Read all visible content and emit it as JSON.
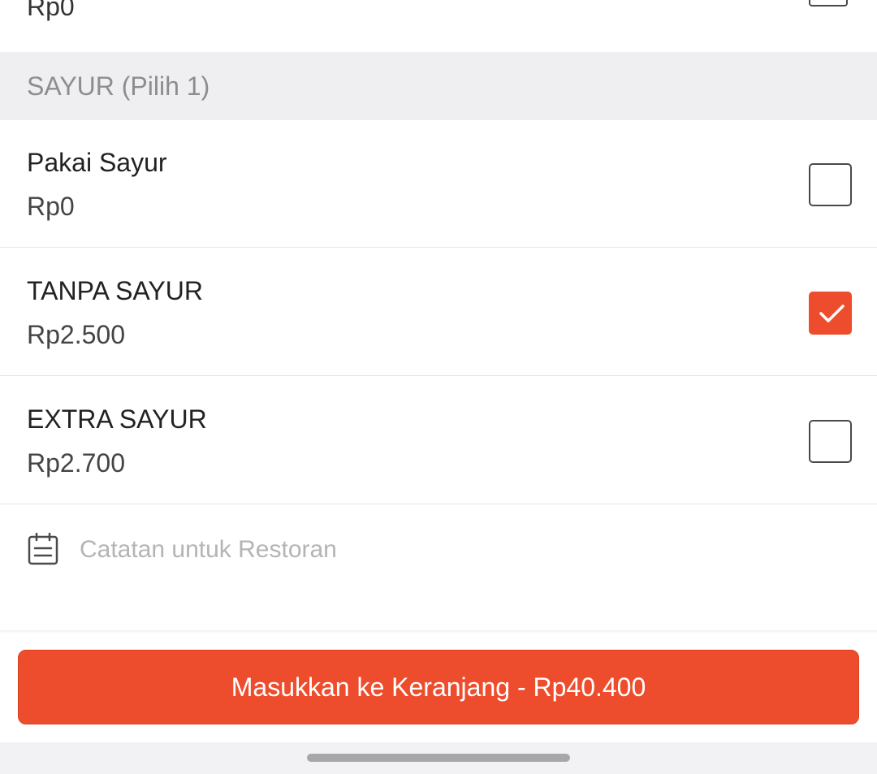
{
  "previous_option": {
    "price": "Rp0",
    "checked": false
  },
  "section": {
    "title": "SAYUR (Pilih 1)"
  },
  "options": [
    {
      "name": "Pakai Sayur",
      "price": "Rp0",
      "checked": false
    },
    {
      "name": "TANPA  SAYUR",
      "price": "Rp2.500",
      "checked": true
    },
    {
      "name": "EXTRA SAYUR",
      "price": "Rp2.700",
      "checked": false
    }
  ],
  "notes": {
    "placeholder": "Catatan untuk Restoran",
    "value": "",
    "icon": "notepad-icon"
  },
  "cart_button": {
    "label": "Masukkan ke Keranjang - Rp40.400"
  },
  "colors": {
    "accent": "#ee4d2d",
    "section_bg": "#efeff1",
    "section_text": "#8d8d8f",
    "placeholder_text": "#b4b4b6"
  }
}
